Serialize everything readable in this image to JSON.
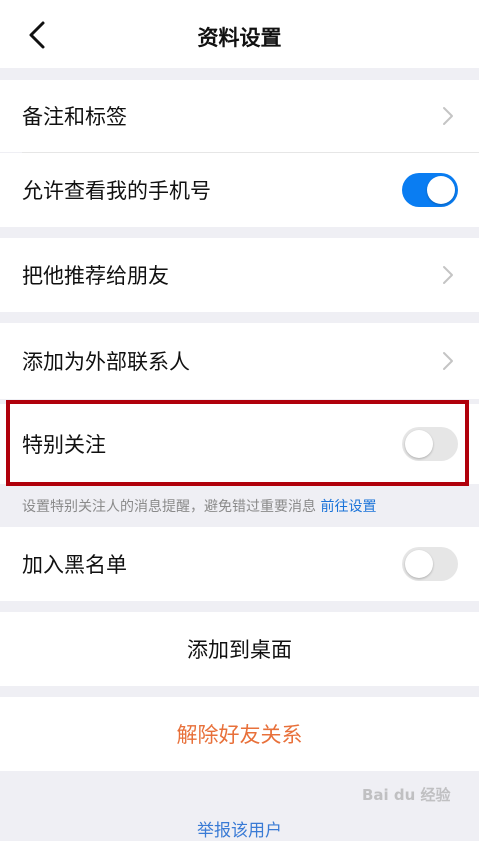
{
  "header": {
    "title": "资料设置"
  },
  "rows": {
    "remark_tags": "备注和标签",
    "allow_view_phone": "允许查看我的手机号",
    "recommend_to_friend": "把他推荐给朋友",
    "add_external_contact": "添加为外部联系人",
    "special_attention": "特别关注",
    "blacklist": "加入黑名单",
    "add_to_desktop": "添加到桌面",
    "remove_friend": "解除好友关系"
  },
  "toggles": {
    "allow_view_phone": true,
    "special_attention": false,
    "blacklist": false
  },
  "hint": {
    "text": "设置特别关注人的消息提醒，避免错过重要消息",
    "link": "前往设置"
  },
  "footer": {
    "report": "举报该用户"
  },
  "watermark": "Bai du 经验",
  "colors": {
    "toggle_on": "#0a7df2",
    "danger": "#e8703a",
    "link": "#1a73d9",
    "highlight_border": "#b0000b"
  },
  "icons": {
    "back": "chevron-left-icon",
    "row_arrow": "chevron-right-icon"
  }
}
